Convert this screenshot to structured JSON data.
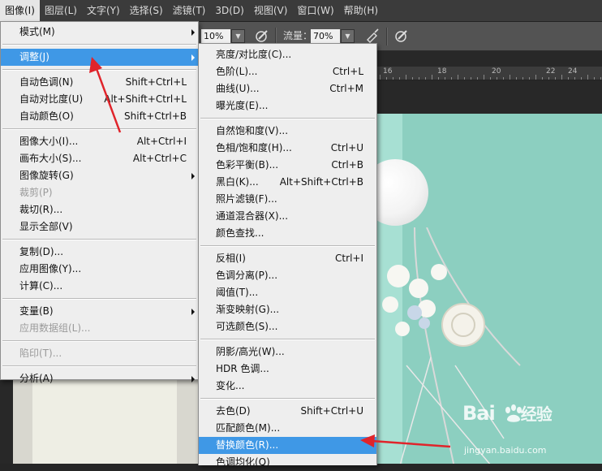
{
  "menubar": {
    "items": [
      "图像(I)",
      "图层(L)",
      "文字(Y)",
      "选择(S)",
      "滤镜(T)",
      "3D(D)",
      "视图(V)",
      "窗口(W)",
      "帮助(H)"
    ],
    "active_index": 0
  },
  "options": {
    "opacity_value": "10%",
    "flow_label": "流量：",
    "flow_value": "70%"
  },
  "ruler": {
    "labels": [
      "16",
      "18",
      "20",
      "22",
      "24"
    ]
  },
  "image_menu": [
    {
      "label": "模式(M)",
      "submenu": true
    },
    {
      "sep": true
    },
    {
      "label": "调整(J)",
      "submenu": true,
      "highlighted": true
    },
    {
      "sep": true
    },
    {
      "label": "自动色调(N)",
      "shortcut": "Shift+Ctrl+L"
    },
    {
      "label": "自动对比度(U)",
      "shortcut": "Alt+Shift+Ctrl+L"
    },
    {
      "label": "自动颜色(O)",
      "shortcut": "Shift+Ctrl+B"
    },
    {
      "sep": true
    },
    {
      "label": "图像大小(I)...",
      "shortcut": "Alt+Ctrl+I"
    },
    {
      "label": "画布大小(S)...",
      "shortcut": "Alt+Ctrl+C"
    },
    {
      "label": "图像旋转(G)",
      "submenu": true
    },
    {
      "label": "裁剪(P)",
      "disabled": true
    },
    {
      "label": "裁切(R)..."
    },
    {
      "label": "显示全部(V)"
    },
    {
      "sep": true
    },
    {
      "label": "复制(D)..."
    },
    {
      "label": "应用图像(Y)..."
    },
    {
      "label": "计算(C)..."
    },
    {
      "sep": true
    },
    {
      "label": "变量(B)",
      "submenu": true
    },
    {
      "label": "应用数据组(L)...",
      "disabled": true
    },
    {
      "sep": true
    },
    {
      "label": "陷印(T)...",
      "disabled": true
    },
    {
      "sep": true
    },
    {
      "label": "分析(A)",
      "submenu": true
    }
  ],
  "adjust_menu": [
    {
      "label": "亮度/对比度(C)..."
    },
    {
      "label": "色阶(L)...",
      "shortcut": "Ctrl+L"
    },
    {
      "label": "曲线(U)...",
      "shortcut": "Ctrl+M"
    },
    {
      "label": "曝光度(E)..."
    },
    {
      "sep": true
    },
    {
      "label": "自然饱和度(V)..."
    },
    {
      "label": "色相/饱和度(H)...",
      "shortcut": "Ctrl+U"
    },
    {
      "label": "色彩平衡(B)...",
      "shortcut": "Ctrl+B"
    },
    {
      "label": "黑白(K)...",
      "shortcut": "Alt+Shift+Ctrl+B"
    },
    {
      "label": "照片滤镜(F)..."
    },
    {
      "label": "通道混合器(X)..."
    },
    {
      "label": "颜色查找..."
    },
    {
      "sep": true
    },
    {
      "label": "反相(I)",
      "shortcut": "Ctrl+I"
    },
    {
      "label": "色调分离(P)..."
    },
    {
      "label": "阈值(T)..."
    },
    {
      "label": "渐变映射(G)..."
    },
    {
      "label": "可选颜色(S)..."
    },
    {
      "sep": true
    },
    {
      "label": "阴影/高光(W)..."
    },
    {
      "label": "HDR 色调..."
    },
    {
      "label": "变化..."
    },
    {
      "sep": true
    },
    {
      "label": "去色(D)",
      "shortcut": "Shift+Ctrl+U"
    },
    {
      "label": "匹配颜色(M)..."
    },
    {
      "label": "替换颜色(R)...",
      "highlighted": true
    },
    {
      "label": "色调均化(Q)"
    }
  ],
  "watermark": {
    "brand": "Bai",
    "suffix": "经验",
    "url": "jingyan.baidu.com"
  },
  "colors": {
    "highlight": "#3f98e6",
    "annotation_arrow": "#e0242b"
  }
}
